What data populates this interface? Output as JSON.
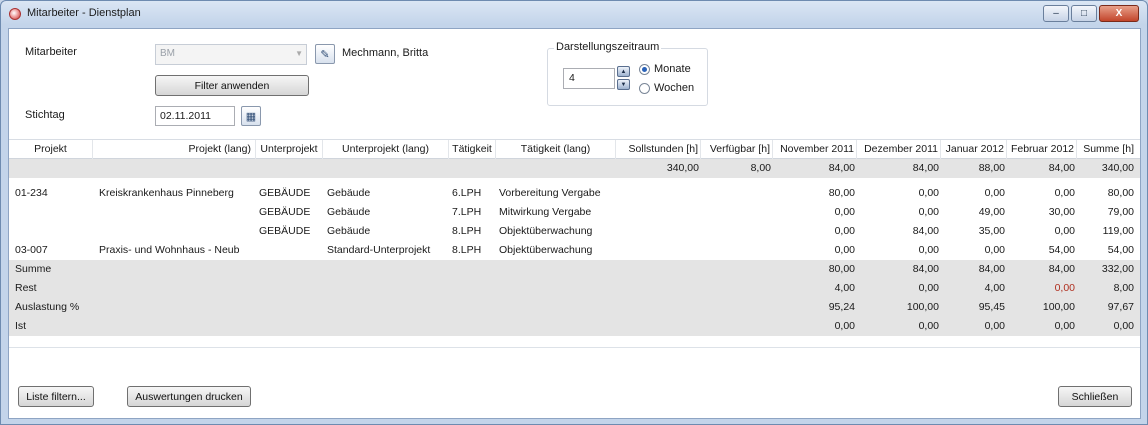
{
  "window": {
    "title": "Mitarbeiter - Dienstplan",
    "controls": [
      "–",
      "□",
      "X"
    ]
  },
  "filter": {
    "mitarbeiter_label": "Mitarbeiter",
    "mitarbeiter_code": "BM",
    "mitarbeiter_name": "Mechmann, Britta",
    "filter_button": "Filter anwenden",
    "stichtag_label": "Stichtag",
    "stichtag_value": "02.11.2011"
  },
  "zeitraum": {
    "legend": "Darstellungszeitraum",
    "value": "4",
    "option_monate": "Monate",
    "option_wochen": "Wochen",
    "selected": "Monate"
  },
  "table": {
    "headers": [
      "Projekt",
      "Projekt (lang)",
      "Unterprojekt",
      "Unterprojekt (lang)",
      "Tätigkeit",
      "Tätigkeit (lang)",
      "Sollstunden [h]",
      "Verfügbar [h]",
      "November 2011",
      "Dezember 2011",
      "Januar 2012",
      "Februar 2012",
      "Summe [h]"
    ],
    "top_row": [
      "",
      "",
      "",
      "",
      "",
      "",
      "340,00",
      "8,00",
      "84,00",
      "84,00",
      "88,00",
      "84,00",
      "340,00"
    ],
    "rows": [
      [
        "01-234",
        "Kreiskrankenhaus Pinneberg",
        "GEBÄUDE",
        "Gebäude",
        "6.LPH",
        "Vorbereitung Vergabe",
        "",
        "",
        "80,00",
        "0,00",
        "0,00",
        "0,00",
        "80,00"
      ],
      [
        "",
        "",
        "GEBÄUDE",
        "Gebäude",
        "7.LPH",
        "Mitwirkung Vergabe",
        "",
        "",
        "0,00",
        "0,00",
        "49,00",
        "30,00",
        "79,00"
      ],
      [
        "",
        "",
        "GEBÄUDE",
        "Gebäude",
        "8.LPH",
        "Objektüberwachung",
        "",
        "",
        "0,00",
        "84,00",
        "35,00",
        "0,00",
        "119,00"
      ],
      [
        "03-007",
        "Praxis- und Wohnhaus - Neub",
        "",
        "Standard-Unterprojekt",
        "8.LPH",
        "Objektüberwachung",
        "",
        "",
        "0,00",
        "0,00",
        "0,00",
        "54,00",
        "54,00"
      ]
    ],
    "summary_rows": [
      {
        "label": "Summe",
        "values": [
          "80,00",
          "84,00",
          "84,00",
          "84,00",
          "332,00"
        ]
      },
      {
        "label": "Rest",
        "values": [
          "4,00",
          "0,00",
          "4,00",
          "0,00",
          "8,00"
        ]
      },
      {
        "label": "Auslastung %",
        "values": [
          "95,24",
          "100,00",
          "95,45",
          "100,00",
          "97,67"
        ]
      },
      {
        "label": "Ist",
        "values": [
          "0,00",
          "0,00",
          "0,00",
          "0,00",
          "0,00"
        ]
      }
    ],
    "negative_color": "#b03020"
  },
  "footer": {
    "liste_filtern": "Liste filtern...",
    "auswertungen": "Auswertungen drucken",
    "schliessen": "Schließen"
  }
}
